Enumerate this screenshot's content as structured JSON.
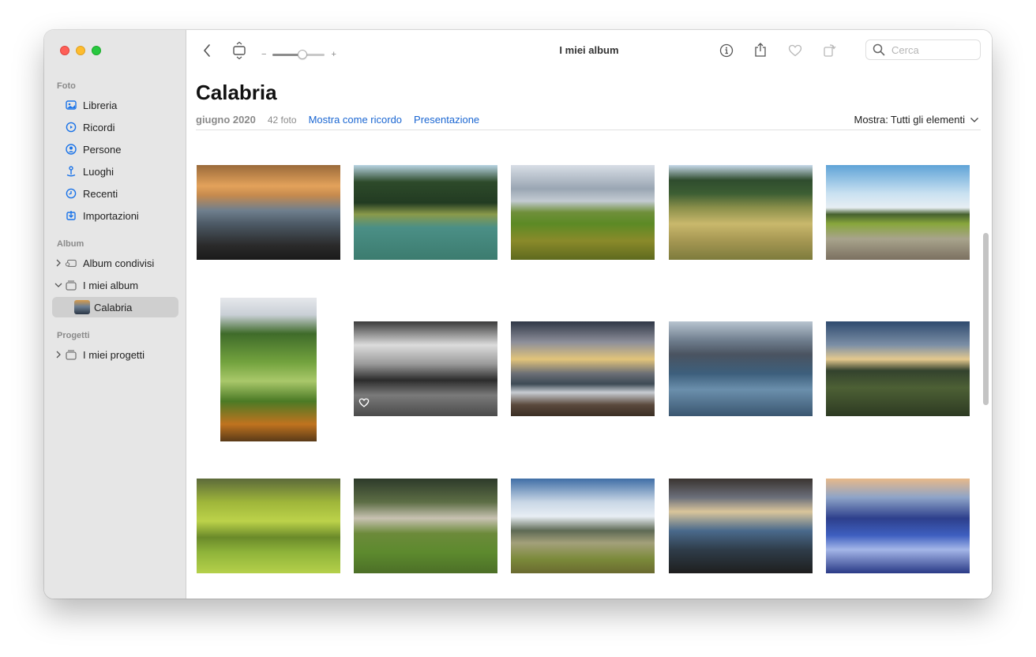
{
  "window": {
    "title": "I miei album"
  },
  "sidebar": {
    "sections": {
      "foto": "Foto",
      "album": "Album",
      "progetti": "Progetti"
    },
    "library_items": [
      {
        "label": "Libreria",
        "icon": "photo-library-icon"
      },
      {
        "label": "Ricordi",
        "icon": "memories-icon"
      },
      {
        "label": "Persone",
        "icon": "people-icon"
      },
      {
        "label": "Luoghi",
        "icon": "places-icon"
      },
      {
        "label": "Recenti",
        "icon": "recents-icon"
      },
      {
        "label": "Importazioni",
        "icon": "imports-icon"
      }
    ],
    "album_items": [
      {
        "label": "Album condivisi",
        "icon": "shared-album-icon",
        "expanded": false
      },
      {
        "label": "I miei album",
        "icon": "album-folder-icon",
        "expanded": true
      },
      {
        "label": "Calabria",
        "icon": "album-thumbnail",
        "selected": true
      }
    ],
    "project_items": [
      {
        "label": "I miei progetti",
        "icon": "project-folder-icon",
        "expanded": false
      }
    ]
  },
  "toolbar": {
    "slider_minus": "−",
    "slider_plus": "+",
    "zoom_level": 0.6,
    "search_placeholder": "Cerca"
  },
  "album": {
    "title": "Calabria",
    "date": "giugno 2020",
    "count": "42 foto",
    "show_as_memory": "Mostra come ricordo",
    "slideshow": "Presentazione",
    "filter_label": "Mostra:",
    "filter_value": "Tutti gli elementi"
  },
  "colors": {
    "accent": "#1a66d2",
    "sidebar_bg": "#e6e6e6",
    "selected_bg": "#cfcfcf"
  },
  "photos": [
    {
      "name": "photo-sunset-mountains",
      "favorite": false,
      "bg": "linear-gradient(180deg,#9a6a3a 0%,#e3a25b 22%,#c58a4e 32%,#6f7f8e 48%,#4d5a66 62%,#2a2a2a 85%,#1a1a1a 100%)"
    },
    {
      "name": "photo-lake-forest",
      "favorite": false,
      "bg": "linear-gradient(180deg,#b7d3e2 0%,#2d4a2a 18%,#223b22 40%,#8a9a4a 52%,#4b8f86 66%,#3c7c6f 100%)"
    },
    {
      "name": "photo-green-hills",
      "favorite": false,
      "bg": "linear-gradient(180deg,#d8dee6 0%,#9aa6b3 25%,#c3cbd2 38%,#6f8f3a 50%,#5c8a25 62%,#8a8a2a 80%,#5e6a1e 100%)"
    },
    {
      "name": "photo-fields-red-car",
      "favorite": false,
      "bg": "linear-gradient(180deg,#c7d9ea 0%,#2f4c2e 16%,#3c5e33 30%,#8a8f4a 45%,#c9b86c 62%,#a99a55 78%,#7d7b3c 100%)"
    },
    {
      "name": "photo-railway-pole",
      "favorite": false,
      "bg": "linear-gradient(180deg,#5fa3d7 0%,#c9e1f1 30%,#e7eef3 45%,#46612f 52%,#88a63c 62%,#a8a38c 78%,#7b7060 100%)"
    },
    {
      "name": "photo-green-valley-portrait",
      "favorite": false,
      "bg": "linear-gradient(180deg,#e6e8ec 0%,#c9cfd6 12%,#3f6b2a 25%,#73a33e 45%,#a9c86a 58%,#4b7a25 72%,#c0731f 88%,#5a3a18 100%)"
    },
    {
      "name": "photo-horses-bw",
      "favorite": true,
      "bg": "linear-gradient(180deg,#3a3a3a 0%,#dcdcdc 25%,#9a9a9a 45%,#2c2c2c 62%,#7a7a7a 78%,#4a4a4a 100%)"
    },
    {
      "name": "photo-sea-sunrays",
      "favorite": false,
      "bg": "linear-gradient(180deg,#2f3746 0%,#8d8f9a 22%,#e2c47a 40%,#6c6f76 55%,#3d4a55 66%,#c7ccd2 75%,#5b4a3d 88%,#3a2e24 100%)"
    },
    {
      "name": "photo-rocky-coast",
      "favorite": false,
      "bg": "linear-gradient(180deg,#b8c4d0 0%,#6f7e8e 20%,#4a5360 35%,#3d5f7c 55%,#6b8fac 72%,#3a5670 100%)"
    },
    {
      "name": "photo-river-valley-evening",
      "favorite": false,
      "bg": "linear-gradient(180deg,#2e4a6e 0%,#7c8fa6 25%,#e4c98e 40%,#33422d 52%,#4d6035 70%,#2d3a22 100%)"
    },
    {
      "name": "photo-willow-field",
      "favorite": false,
      "bg": "linear-gradient(180deg,#5c6a3a 0%,#9fb63a 25%,#bcd24a 45%,#6a8a2a 62%,#8fb43a 78%,#b5d04a 100%)"
    },
    {
      "name": "photo-farmhouse-valley",
      "favorite": false,
      "bg": "linear-gradient(180deg,#2d3a2a 0%,#5d6e45 25%,#c8c2b2 42%,#6c8a3a 58%,#5d8a2e 78%,#4c6f27 100%)"
    },
    {
      "name": "photo-lake-trees",
      "favorite": false,
      "bg": "linear-gradient(180deg,#3f6ea6 0%,#c9d7e6 25%,#e8eef4 40%,#5e6a55 55%,#a3a07a 68%,#7b8a3a 85%,#6a6a30 100%)"
    },
    {
      "name": "photo-coast-balcony",
      "favorite": false,
      "bg": "linear-gradient(180deg,#3a3430 0%,#6b6f7a 20%,#d9c59b 35%,#4a6a8c 55%,#2f3d4a 75%,#1e1e1e 100%)"
    },
    {
      "name": "photo-blue-waves",
      "favorite": false,
      "bg": "linear-gradient(180deg,#e7b98a 0%,#8ea4c8 20%,#2d3f8c 42%,#3e5fc0 60%,#a4b6e8 75%,#2a3a86 100%)"
    }
  ]
}
